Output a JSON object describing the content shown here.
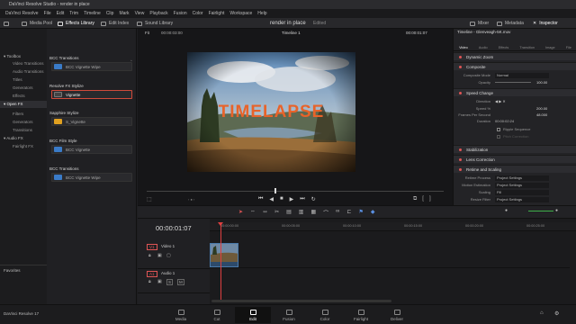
{
  "app": {
    "title": "DaVinci Resolve Studio - render in place",
    "footer": "DaVinci Resolve 17"
  },
  "menu": [
    "DaVinci Resolve",
    "File",
    "Edit",
    "Trim",
    "Timeline",
    "Clip",
    "Mark",
    "View",
    "Playback",
    "Fusion",
    "Color",
    "Fairlight",
    "Workspace",
    "Help"
  ],
  "toolbar": {
    "media_pool": "Media Pool",
    "effects_library": "Effects Library",
    "edit_index": "Edit Index",
    "sound_library": "Sound Library",
    "project": "render in place",
    "project_status": "Edited",
    "mixer": "Mixer",
    "metadata": "Metadata",
    "inspector": "Inspector"
  },
  "effects": {
    "search_value": "vignett",
    "tree": {
      "toolbox": "Toolbox",
      "video_transitions": "Video Transitions",
      "audio_transitions": "Audio Transitions",
      "titles": "Titles",
      "generators": "Generators",
      "effects": "Effects",
      "open_fx": "Open FX",
      "filters": "Filters",
      "ofx_generators": "Generators",
      "ofx_transitions": "Transitions",
      "audio_fx": "Audio FX",
      "fairlight_fx": "Fairlight FX",
      "favorites": "Favorites"
    },
    "groups": [
      {
        "title": "BCC Transitions",
        "item": "BCC Vignette Wipe"
      },
      {
        "title": "Resolve FX Stylize",
        "item": "Vignette"
      },
      {
        "title": "Sapphire Stylize",
        "item": "S_Vignette"
      },
      {
        "title": "BCC Film Style",
        "item": "BCC Vignette"
      },
      {
        "title": "BCC Transitions",
        "item": "BCC Vignette Wipe"
      }
    ]
  },
  "viewer": {
    "fit": "Fit",
    "src_tc": "00:00:03:00",
    "timeline_name": "Timeline 1",
    "tc": "00:00:01:07",
    "overlay_text": "TIMELAPSE",
    "overlay_color": "#e8632a"
  },
  "inspector": {
    "clip_title": "Timeline - Glenveagh-5K.mov",
    "tabs": [
      "Video",
      "Audio",
      "Effects",
      "Transition",
      "Image",
      "File"
    ],
    "sections": {
      "dynamic_zoom": "Dynamic Zoom",
      "composite": "Composite",
      "speed_change": "Speed Change",
      "stabilization": "Stabilization",
      "lens_correction": "Lens Correction",
      "retime": "Retime and Scaling"
    },
    "composite_mode_label": "Composite Mode",
    "composite_mode": "Normal",
    "opacity_label": "Opacity",
    "opacity": "100.00",
    "direction_label": "Direction",
    "speed_label": "Speed %",
    "speed": "200.00",
    "fps_label": "Frames Per Second",
    "fps": "48.000",
    "duration_label": "Duration",
    "duration": "00:00:02:24",
    "ripple_label": "Ripple Sequence",
    "pitch_label": "Pitch Correction",
    "retime_process_label": "Retime Process",
    "retime_process": "Project Settings",
    "motion_label": "Motion Estimation",
    "motion": "Project Settings",
    "scaling_label": "Scaling",
    "scaling": "Fill",
    "resize_label": "Resize Filter",
    "resize": "Project Settings"
  },
  "timeline": {
    "tc": "00:00:01:07",
    "ruler": [
      "00:00:00:00",
      "00:00:05:00",
      "00:00:10:00",
      "00:00:15:00",
      "00:00:20:00",
      "00:00:25:00"
    ],
    "v1": "V1",
    "video1": "Video 1",
    "a1": "A1",
    "audio1": "Audio 1",
    "audio_ch": "2.0"
  },
  "pages": [
    "Media",
    "Cut",
    "Edit",
    "Fusion",
    "Color",
    "Fairlight",
    "Deliver"
  ],
  "active_page": "Edit"
}
